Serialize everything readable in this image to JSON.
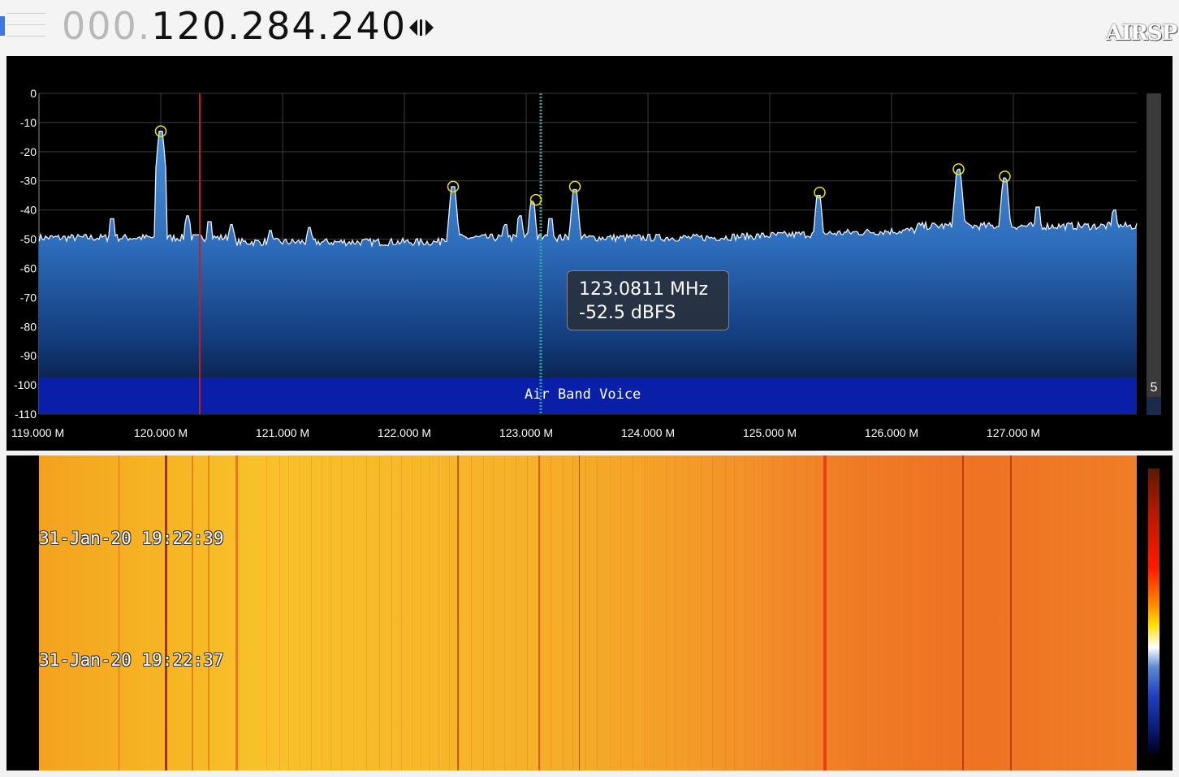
{
  "frequency": {
    "dim_part": "000.",
    "main_part": "120.284.240"
  },
  "logo_text": "AIRSP",
  "spectrum": {
    "y_ticks": [
      "0",
      "-10",
      "-20",
      "-30",
      "-40",
      "-50",
      "-60",
      "-70",
      "-80",
      "-90",
      "-100",
      "-110"
    ],
    "x_ticks": [
      "119.000 M",
      "120.000 M",
      "121.000 M",
      "122.000 M",
      "123.000 M",
      "124.000 M",
      "125.000 M",
      "126.000 M",
      "127.000 M"
    ],
    "band_label": "Air Band Voice",
    "level_value": "5",
    "tooltip": {
      "freq": "123.0811 MHz",
      "level": "-52.5 dBFS"
    }
  },
  "waterfall": {
    "timestamps": [
      "31-Jan-20 19:22:39",
      "31-Jan-20 19:22:37"
    ]
  },
  "colors": {
    "spectrum_fill_top": "#4a8fd6",
    "band_bar": "#0a1fa8",
    "marker": "#f2e600",
    "vfo_line": "#c02020",
    "cursor_line": "#2aa8a0"
  }
}
